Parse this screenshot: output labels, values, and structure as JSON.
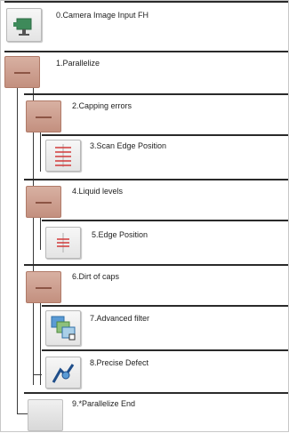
{
  "flow": {
    "items": [
      {
        "label": "0.Camera Image Input FH",
        "icon": "camera-icon"
      },
      {
        "label": "1.Parallelize",
        "icon": "parallelize-icon"
      },
      {
        "label": "2.Capping errors",
        "icon": "parallelize-icon"
      },
      {
        "label": "3.Scan Edge Position",
        "icon": "scan-edge-icon"
      },
      {
        "label": "4.Liquid levels",
        "icon": "parallelize-icon"
      },
      {
        "label": "5.Edge Position",
        "icon": "edge-position-icon"
      },
      {
        "label": "6.Dirt of caps",
        "icon": "parallelize-icon"
      },
      {
        "label": "7.Advanced filter",
        "icon": "advanced-filter-icon"
      },
      {
        "label": "8.Precise Defect",
        "icon": "precise-defect-icon"
      },
      {
        "label": "9.*Parallelize End",
        "icon": "parallelize-end-icon"
      }
    ]
  }
}
